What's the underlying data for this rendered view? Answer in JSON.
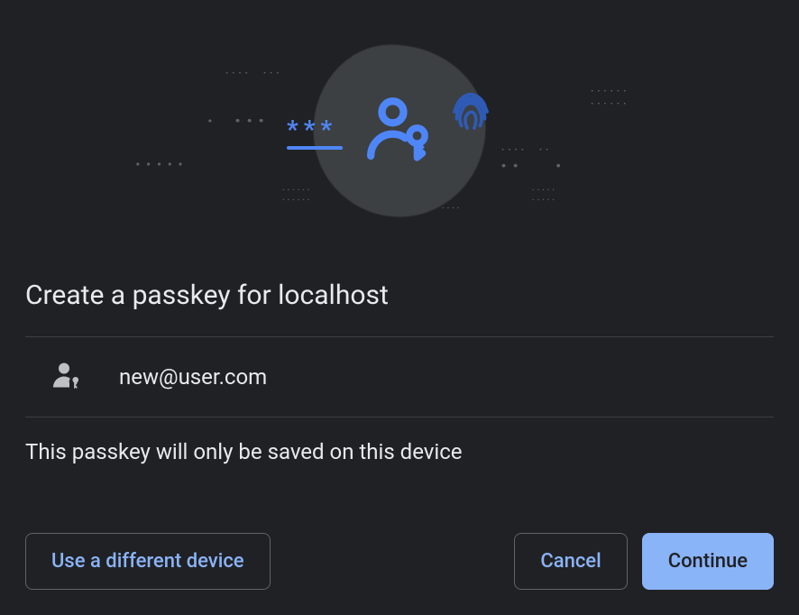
{
  "title": "Create a passkey for localhost",
  "account": {
    "email": "new@user.com"
  },
  "note": "This passkey will only be saved on this device",
  "buttons": {
    "use_different_device": "Use a different device",
    "cancel": "Cancel",
    "continue": "Continue"
  },
  "illustration": {
    "asterisks": "***"
  },
  "colors": {
    "accent": "#4f86f7",
    "button_text": "#8ab4f8",
    "bg": "#202124"
  }
}
